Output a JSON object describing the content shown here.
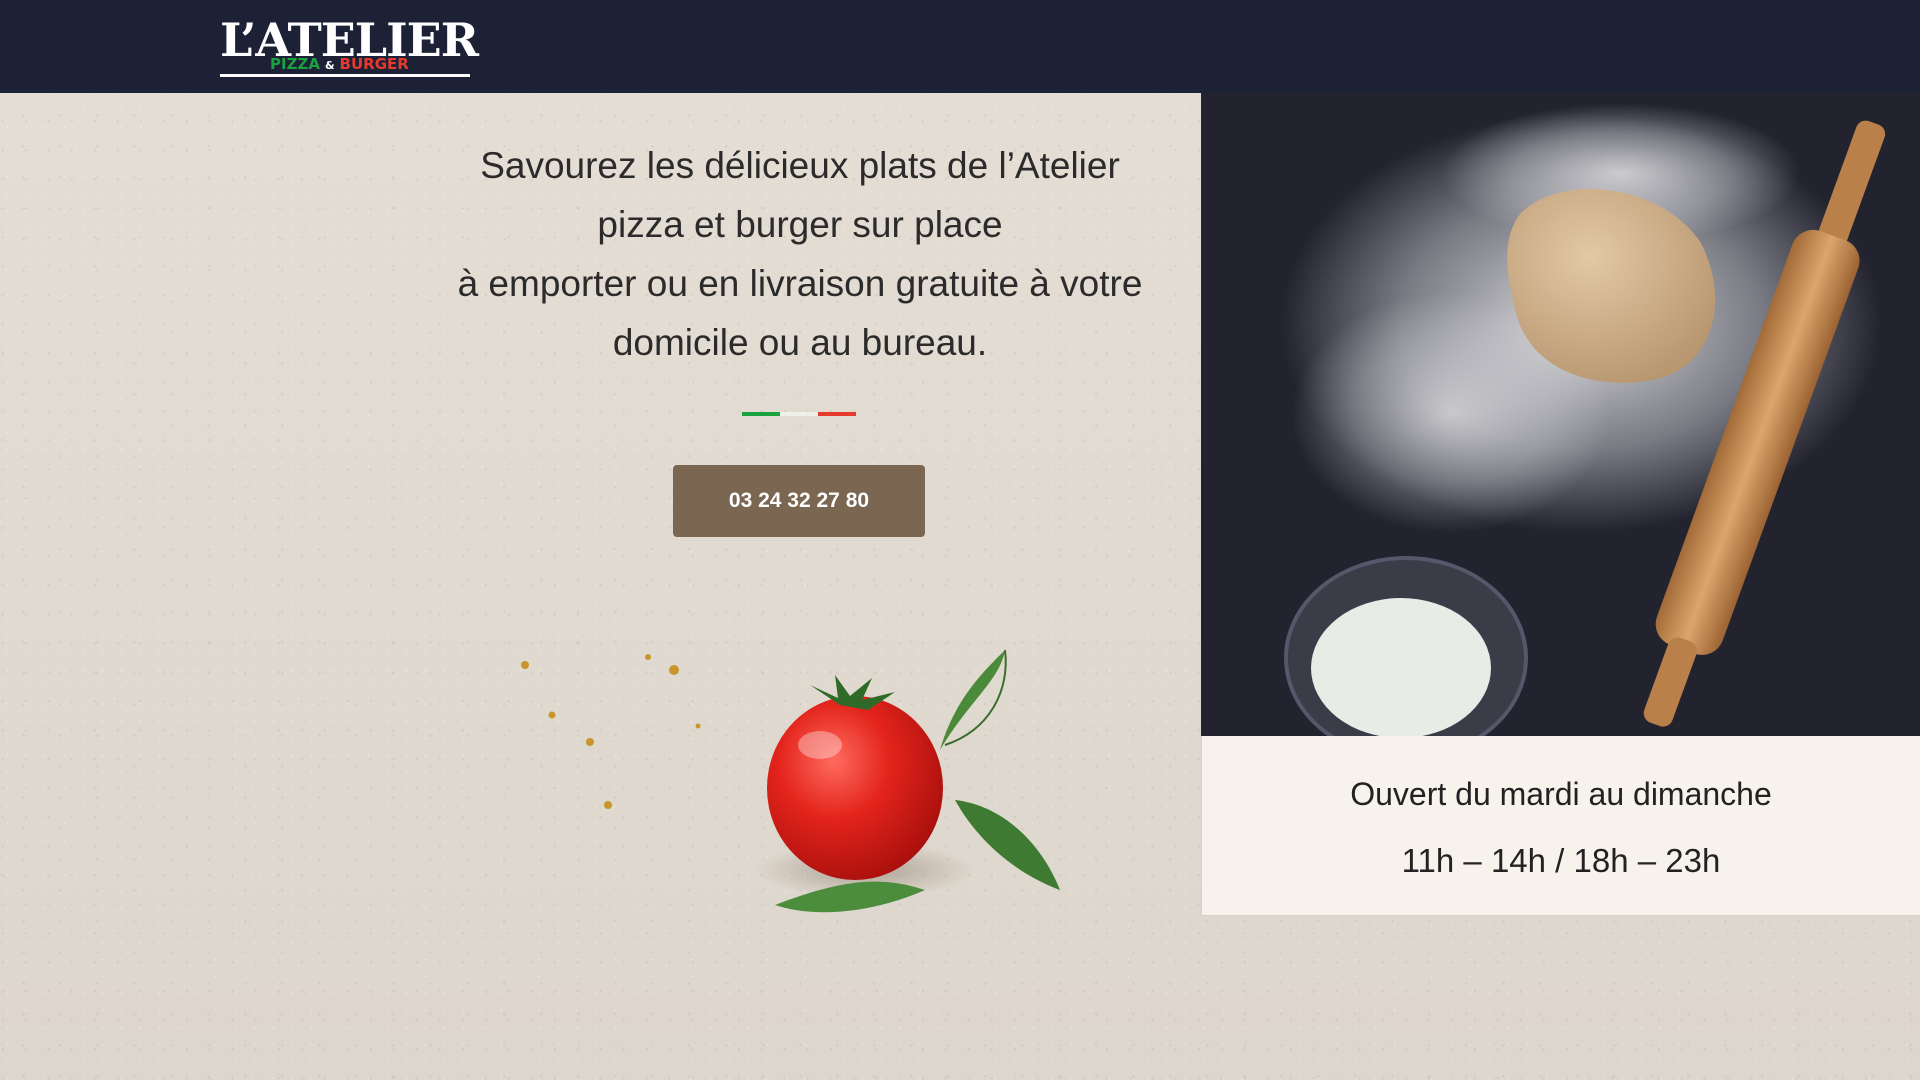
{
  "header": {
    "logo": {
      "main": "L’ATELIER",
      "sub_pizza": "PIZZA",
      "sub_amp": "&",
      "sub_burger": "BURGER"
    },
    "background_color": "#1c2135"
  },
  "hero": {
    "tagline_lines": [
      "Savourez les délicieux plats de l’Atelier",
      "pizza et burger sur place",
      "à emporter ou en livraison gratuite à votre",
      "domicile ou au bureau."
    ],
    "flag_colors": [
      "#19a33e",
      "#f1efe9",
      "#e63a2e"
    ],
    "phone_button_label": "03 24 32 27 80",
    "button_color": "#7a6651"
  },
  "hours": {
    "days": "Ouvert du mardi au dimanche",
    "times": "11h – 14h / 18h – 23h"
  },
  "images": {
    "dough": "dough-rolling-pin-flour-photo",
    "tomato": "tomato-basil-illustration"
  }
}
